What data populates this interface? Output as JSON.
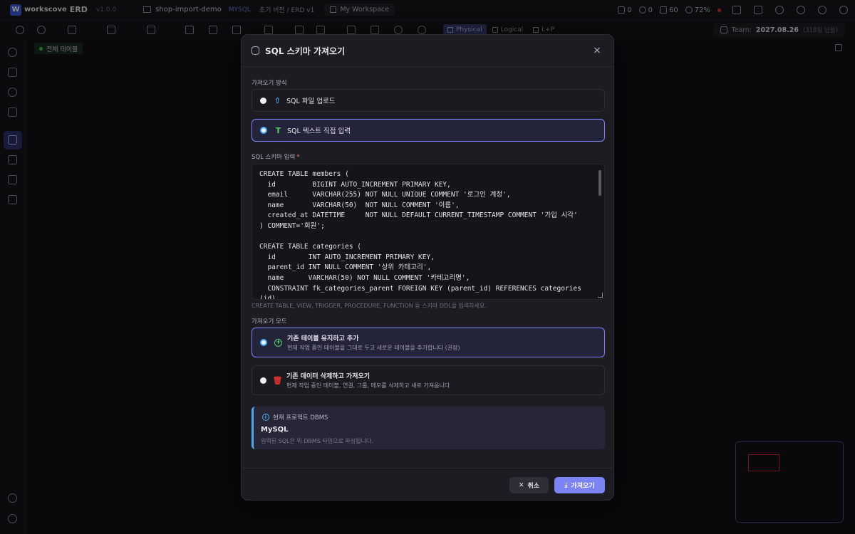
{
  "app": {
    "logo_letter": "W",
    "name": "workscove",
    "product": "ERD",
    "version": "v1.0.0"
  },
  "project": {
    "name": "shop-import-demo",
    "dbms": "MYSQL",
    "branch": "초기 버전 / ERD v1",
    "workspace": "My Workspace"
  },
  "stats": {
    "tables": "0",
    "relations": "0",
    "activity": "60",
    "zoom": "72%"
  },
  "view_modes": [
    "Physical",
    "Logical",
    "L+P"
  ],
  "team": {
    "label": "Team:",
    "date": "2027.08.26",
    "remaining": "(318일 남음)"
  },
  "filter_chip": "전체 테이블",
  "modal": {
    "title": "SQL 스키마 가져오기",
    "close": "×",
    "method_label": "가져오기 방식",
    "method_options": [
      {
        "label": "SQL 파일 업로드"
      },
      {
        "label": "SQL 텍스트 직접 입력"
      }
    ],
    "input_label": "SQL 스키마 입력",
    "required_mark": "*",
    "sql_text": "CREATE TABLE members (\n  id         BIGINT AUTO_INCREMENT PRIMARY KEY,\n  email      VARCHAR(255) NOT NULL UNIQUE COMMENT '로그인 계정',\n  name       VARCHAR(50)  NOT NULL COMMENT '이름',\n  created_at DATETIME     NOT NULL DEFAULT CURRENT_TIMESTAMP COMMENT '가입 시각'\n) COMMENT='회원';\n\nCREATE TABLE categories (\n  id        INT AUTO_INCREMENT PRIMARY KEY,\n  parent_id INT NULL COMMENT '상위 카테고리',\n  name      VARCHAR(50) NOT NULL COMMENT '카테고리명',\n  CONSTRAINT fk_categories_parent FOREIGN KEY (parent_id) REFERENCES categories\n(id)",
    "hint": "CREATE TABLE, VIEW, TRIGGER, PROCEDURE, FUNCTION 등 스키마 DDL을 입력하세요.",
    "mode_label": "가져오기 모드",
    "mode_options": [
      {
        "label": "기존 테이블 유지하고 추가",
        "desc": "현재 작업 중인 테이블을 그대로 두고 새로운 테이블을 추가합니다 (권장)"
      },
      {
        "label": "기존 데이터 삭제하고 가져오기",
        "desc": "현재 작업 중인 테이블, 연결, 그룹, 메모를 삭제하고 새로 가져옵니다"
      }
    ],
    "info_title": "현재 프로젝트 DBMS",
    "info_dbms": "MySQL",
    "info_note": "입력된 SQL은 위 DBMS 타입으로 파싱됩니다.",
    "cancel": "취소",
    "import": "가져오기"
  },
  "colors": {
    "accent": "#7c83f5",
    "selected_border": "#7d86ff",
    "info_bar": "#4dabf7",
    "danger": "#e03131",
    "success": "#40c057"
  }
}
